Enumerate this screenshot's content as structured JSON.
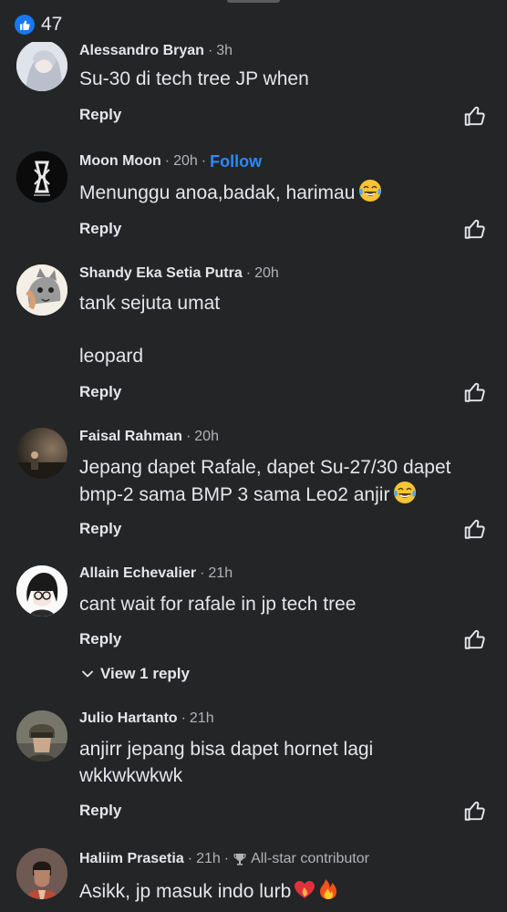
{
  "header": {
    "like_count": "47"
  },
  "reply_label": "Reply",
  "comments": [
    {
      "author": "Alessandro Bryan",
      "time": "3h",
      "text": "Su-30 di tech tree JP when"
    },
    {
      "author": "Moon Moon",
      "time": "20h",
      "follow": "Follow",
      "text": "Menunggu anoa,badak, harimau"
    },
    {
      "author": "Shandy Eka Setia Putra",
      "time": "20h",
      "line1": "tank sejuta umat",
      "line2": "leopard"
    },
    {
      "author": "Faisal Rahman",
      "time": "20h",
      "line1": "Jepang dapet Rafale, dapet Su-27/30 dapet",
      "line2": "bmp-2 sama BMP 3 sama Leo2 anjir"
    },
    {
      "author": "Allain Echevalier",
      "time": "21h",
      "text": "cant wait for rafale in jp tech tree",
      "view_replies": "View 1 reply"
    },
    {
      "author": "Julio Hartanto",
      "time": "21h",
      "line1": "anjirr jepang bisa dapet hornet lagi",
      "line2": "wkkwkwkwk"
    },
    {
      "author": "Haliim Prasetia",
      "time": "21h",
      "badge": "All-star contributor",
      "text": "Asikk, jp masuk indo lurb"
    }
  ],
  "icons": {
    "like_badge": "thumbs-up-icon",
    "comment_like": "thumbs-up-outline-icon",
    "laugh_emoji": "face-with-tears-of-joy-icon",
    "heart_emoji": "heart-on-fire-icon",
    "fire_emoji": "fire-icon",
    "chevron": "chevron-down-icon",
    "trophy": "trophy-icon"
  },
  "colors": {
    "background": "#242526",
    "text": "#e4e6eb",
    "muted": "#b0b3b8",
    "accent": "#2d88ff",
    "like_badge": "#1877f2"
  }
}
